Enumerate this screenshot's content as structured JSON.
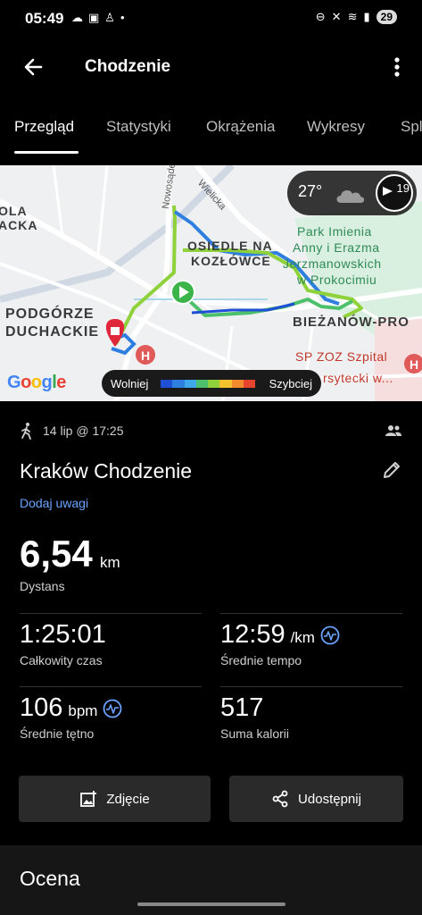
{
  "status_bar": {
    "time": "05:49",
    "battery": "29"
  },
  "app_bar": {
    "title": "Chodzenie"
  },
  "tabs": [
    {
      "label": "Przegląd",
      "active": true
    },
    {
      "label": "Statystyki",
      "active": false
    },
    {
      "label": "Okrążenia",
      "active": false
    },
    {
      "label": "Wykresy",
      "active": false
    },
    {
      "label": "Spl",
      "active": false
    }
  ],
  "map": {
    "labels": {
      "ola": "OLA",
      "acka": "ACKA",
      "osiedle": "OSIEDLE NA",
      "kozlowce": "KOZŁÓWCE",
      "podgorze": "PODGÓRZE",
      "duchackie": "DUCHACKIE",
      "biezanow": "BIEŻANÓW-PRO",
      "park": "Park Imienia",
      "park2": "Anny i Erazma",
      "park3": "Jerzmanowskich",
      "park4": "w Prokocimiu",
      "hospital": "SP ZOZ Szpital",
      "hospital2": "rsytecki w..."
    },
    "streets": {
      "nowosadecka": "Nowosądecka",
      "wielicka": "Wielicka"
    },
    "weather": {
      "temperature": "27°",
      "wind": "19"
    },
    "google": "Google",
    "legend": {
      "slow": "Wolniej",
      "fast": "Szybciej",
      "colors": [
        "#1e4fd6",
        "#2f7fe0",
        "#3fa8e8",
        "#4cc06a",
        "#8fd13a",
        "#f2c12e",
        "#f28a2e",
        "#e8452e"
      ]
    },
    "route_colors": {
      "fast": "#8fd13a",
      "slow": "#2f7fe0",
      "mid": "#4cc06a"
    }
  },
  "activity": {
    "date": "14 lip @ 17:25",
    "title": "Kraków Chodzenie",
    "add_notes": "Dodaj uwagi"
  },
  "distance": {
    "value": "6,54",
    "unit": "km",
    "label": "Dystans"
  },
  "stats": {
    "total_time": {
      "value": "1:25:01",
      "label": "Całkowity czas"
    },
    "avg_pace": {
      "value": "12:59",
      "unit": "/km",
      "label": "Średnie tempo"
    },
    "avg_hr": {
      "value": "106",
      "unit": "bpm",
      "label": "Średnie tętno"
    },
    "calories": {
      "value": "517",
      "label": "Suma kalorii"
    }
  },
  "actions": {
    "photo": "Zdjęcie",
    "share": "Udostępnij"
  },
  "rating": {
    "title": "Ocena"
  }
}
